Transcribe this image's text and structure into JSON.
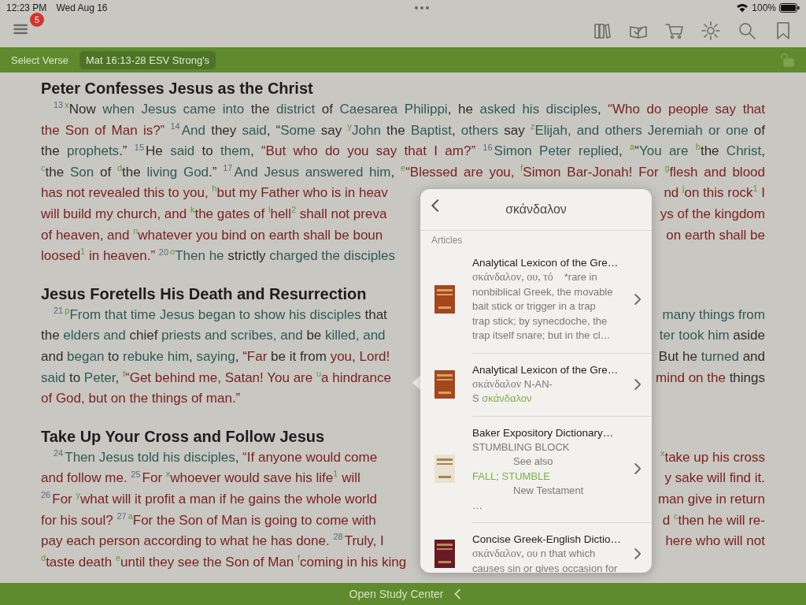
{
  "status_bar": {
    "time": "12:23 PM",
    "date": "Wed Aug 16",
    "battery": "100%"
  },
  "toolbar": {
    "menu_badge": "5"
  },
  "verse_bar": {
    "select_label": "Select Verse",
    "reference": "Mat 16:13-28 ESV Strong's"
  },
  "sections": [
    {
      "heading": "Peter Confesses Jesus as the Christ",
      "lines": [
        {
          "left": [
            {
              "text": "13",
              "kind": "verse"
            },
            {
              "text": "x",
              "kind": "note"
            },
            {
              "text": "Now ",
              "kind": "plain"
            },
            {
              "text": "when Jesus came into",
              "kind": "link"
            },
            {
              "text": " the ",
              "kind": "plain"
            },
            {
              "text": "district",
              "kind": "link"
            },
            {
              "text": " of ",
              "kind": "plain"
            },
            {
              "text": "Caesarea Philippi",
              "kind": "link"
            },
            {
              "text": ", he ",
              "kind": "plain"
            },
            {
              "text": "asked his disciples",
              "kind": "link"
            },
            {
              "text": ", ",
              "kind": "plain"
            },
            {
              "text": "“Who do people say that",
              "kind": "red"
            }
          ]
        },
        {
          "left": [
            {
              "text": "the Son of Man is?” ",
              "kind": "red"
            },
            {
              "text": "14",
              "kind": "verse"
            },
            {
              "text": "And",
              "kind": "link"
            },
            {
              "text": " they ",
              "kind": "plain"
            },
            {
              "text": "said",
              "kind": "link"
            },
            {
              "text": ", “",
              "kind": "plain"
            },
            {
              "text": "Some",
              "kind": "link"
            },
            {
              "text": " say ",
              "kind": "plain"
            },
            {
              "text": "y",
              "kind": "note"
            },
            {
              "text": "John",
              "kind": "link"
            },
            {
              "text": " the ",
              "kind": "plain"
            },
            {
              "text": "Baptist",
              "kind": "link"
            },
            {
              "text": ", ",
              "kind": "plain"
            },
            {
              "text": "others",
              "kind": "link"
            },
            {
              "text": " say ",
              "kind": "plain"
            },
            {
              "text": "z",
              "kind": "note"
            },
            {
              "text": "Elijah, and others Jeremiah or one",
              "kind": "link"
            },
            {
              "text": " of",
              "kind": "plain"
            }
          ]
        },
        {
          "left": [
            {
              "text": "the ",
              "kind": "plain"
            },
            {
              "text": "prophets",
              "kind": "link"
            },
            {
              "text": ".” ",
              "kind": "plain"
            },
            {
              "text": "15",
              "kind": "verse"
            },
            {
              "text": "He ",
              "kind": "plain"
            },
            {
              "text": "said",
              "kind": "link"
            },
            {
              "text": " to ",
              "kind": "plain"
            },
            {
              "text": "them",
              "kind": "link"
            },
            {
              "text": ", ",
              "kind": "plain"
            },
            {
              "text": "“But who do you say that I am?” ",
              "kind": "red"
            },
            {
              "text": "16",
              "kind": "verse"
            },
            {
              "text": "Simon Peter replied",
              "kind": "link"
            },
            {
              "text": ", ",
              "kind": "plain"
            },
            {
              "text": "a",
              "kind": "note"
            },
            {
              "text": "“",
              "kind": "plain"
            },
            {
              "text": "You are ",
              "kind": "link"
            },
            {
              "text": "b",
              "kind": "note"
            },
            {
              "text": "the ",
              "kind": "plain"
            },
            {
              "text": "Christ",
              "kind": "link"
            },
            {
              "text": ",",
              "kind": "plain"
            }
          ]
        },
        {
          "left": [
            {
              "text": "c",
              "kind": "note"
            },
            {
              "text": "the ",
              "kind": "plain"
            },
            {
              "text": "Son",
              "kind": "link"
            },
            {
              "text": " of ",
              "kind": "plain"
            },
            {
              "text": "d",
              "kind": "note"
            },
            {
              "text": "the ",
              "kind": "plain"
            },
            {
              "text": "living God",
              "kind": "link"
            },
            {
              "text": ".” ",
              "kind": "plain"
            },
            {
              "text": "17",
              "kind": "verse"
            },
            {
              "text": "And Jesus answered him",
              "kind": "link"
            },
            {
              "text": ", ",
              "kind": "plain"
            },
            {
              "text": "e",
              "kind": "note"
            },
            {
              "text": "“Blessed are you, ",
              "kind": "red"
            },
            {
              "text": "f",
              "kind": "note"
            },
            {
              "text": "Simon Bar-Jonah! For ",
              "kind": "red"
            },
            {
              "text": "g",
              "kind": "note"
            },
            {
              "text": "flesh and blood",
              "kind": "red"
            }
          ]
        },
        {
          "left": [
            {
              "text": "has not revealed this to you, ",
              "kind": "red"
            },
            {
              "text": "h",
              "kind": "note"
            },
            {
              "text": "but my Father who is in heav",
              "kind": "red"
            }
          ],
          "right": [
            {
              "text": "nd ",
              "kind": "red"
            },
            {
              "text": "j",
              "kind": "note"
            },
            {
              "text": "on this rock",
              "kind": "red"
            },
            {
              "text": "1",
              "kind": "footnote"
            },
            {
              "text": " I",
              "kind": "red"
            }
          ]
        },
        {
          "left": [
            {
              "text": "will build my church, and ",
              "kind": "red"
            },
            {
              "text": "k",
              "kind": "note"
            },
            {
              "text": "the gates of ",
              "kind": "red"
            },
            {
              "text": "l",
              "kind": "note"
            },
            {
              "text": "hell",
              "kind": "red"
            },
            {
              "text": "2",
              "kind": "footnote"
            },
            {
              "text": " shall not preva",
              "kind": "red"
            }
          ],
          "right": [
            {
              "text": "ys of the kingdom",
              "kind": "red"
            }
          ]
        },
        {
          "left": [
            {
              "text": "of heaven, and ",
              "kind": "red"
            },
            {
              "text": "n",
              "kind": "note"
            },
            {
              "text": "whatever you bind on earth shall be boun",
              "kind": "red"
            }
          ],
          "right": [
            {
              "text": "on earth shall be",
              "kind": "red"
            }
          ]
        },
        {
          "left": [
            {
              "text": "loosed",
              "kind": "red"
            },
            {
              "text": "1",
              "kind": "footnote"
            },
            {
              "text": " in heaven.” ",
              "kind": "red"
            },
            {
              "text": "20",
              "kind": "verse"
            },
            {
              "text": "o",
              "kind": "note"
            },
            {
              "text": "Then he",
              "kind": "link"
            },
            {
              "text": " strictly ",
              "kind": "plain"
            },
            {
              "text": "charged the disciples",
              "kind": "link"
            }
          ]
        }
      ]
    },
    {
      "heading": "Jesus Foretells His Death and Resurrection",
      "lines": [
        {
          "left": [
            {
              "text": "21",
              "kind": "verse"
            },
            {
              "text": "p",
              "kind": "note"
            },
            {
              "text": "From that time Jesus began to show his disciples",
              "kind": "link"
            },
            {
              "text": " that",
              "kind": "plain"
            }
          ],
          "right": [
            {
              "text": "many things from",
              "kind": "link"
            }
          ]
        },
        {
          "left": [
            {
              "text": "the ",
              "kind": "plain"
            },
            {
              "text": "elders and",
              "kind": "link"
            },
            {
              "text": " chief ",
              "kind": "plain"
            },
            {
              "text": "priests and scribes, and",
              "kind": "link"
            },
            {
              "text": " be ",
              "kind": "plain"
            },
            {
              "text": "killed, and",
              "kind": "link"
            }
          ],
          "right": [
            {
              "text": "ter took him",
              "kind": "link"
            },
            {
              "text": " aside",
              "kind": "plain"
            }
          ]
        },
        {
          "left": [
            {
              "text": "and ",
              "kind": "plain"
            },
            {
              "text": "began",
              "kind": "link"
            },
            {
              "text": " to ",
              "kind": "plain"
            },
            {
              "text": "rebuke him",
              "kind": "link"
            },
            {
              "text": ", ",
              "kind": "plain"
            },
            {
              "text": "saying",
              "kind": "link"
            },
            {
              "text": ", “",
              "kind": "plain"
            },
            {
              "text": "Far",
              "kind": "red"
            },
            {
              "text": " be it from ",
              "kind": "plain"
            },
            {
              "text": "you",
              "kind": "red"
            },
            {
              "text": ", ",
              "kind": "plain"
            },
            {
              "text": "Lord!",
              "kind": "red"
            }
          ],
          "right": [
            {
              "text": "But he ",
              "kind": "plain"
            },
            {
              "text": "turned",
              "kind": "link"
            },
            {
              "text": " and",
              "kind": "plain"
            }
          ]
        },
        {
          "left": [
            {
              "text": "said",
              "kind": "link"
            },
            {
              "text": " to ",
              "kind": "plain"
            },
            {
              "text": "Peter",
              "kind": "link"
            },
            {
              "text": ", ",
              "kind": "plain"
            },
            {
              "text": "t",
              "kind": "note"
            },
            {
              "text": "“Get behind me, Satan! You are ",
              "kind": "red"
            },
            {
              "text": "u",
              "kind": "note"
            },
            {
              "text": "a hindrance",
              "kind": "red"
            }
          ],
          "right": [
            {
              "text": "mind on the",
              "kind": "red"
            },
            {
              "text": " things",
              "kind": "plain"
            }
          ]
        },
        {
          "left": [
            {
              "text": "of God, but on the things of man.”",
              "kind": "red"
            }
          ]
        }
      ]
    },
    {
      "heading": "Take Up Your Cross and Follow Jesus",
      "lines": [
        {
          "left": [
            {
              "text": "24",
              "kind": "verse"
            },
            {
              "text": "Then Jesus told his disciples",
              "kind": "link"
            },
            {
              "text": ", ",
              "kind": "plain"
            },
            {
              "text": "“If anyone would come",
              "kind": "red"
            }
          ],
          "right": [
            {
              "text": "x",
              "kind": "note"
            },
            {
              "text": "take up his cross",
              "kind": "red"
            }
          ]
        },
        {
          "left": [
            {
              "text": "and follow me. ",
              "kind": "red"
            },
            {
              "text": "25",
              "kind": "verse"
            },
            {
              "text": "For ",
              "kind": "red"
            },
            {
              "text": "x",
              "kind": "note"
            },
            {
              "text": "whoever would save his life",
              "kind": "red"
            },
            {
              "text": "1",
              "kind": "footnote"
            },
            {
              "text": " will",
              "kind": "red"
            }
          ],
          "right": [
            {
              "text": "y sake will find it.",
              "kind": "red"
            }
          ]
        },
        {
          "left": [
            {
              "text": "26",
              "kind": "verse"
            },
            {
              "text": "For ",
              "kind": "red"
            },
            {
              "text": "y",
              "kind": "note"
            },
            {
              "text": "what will it profit a man if he gains the whole world",
              "kind": "red"
            }
          ],
          "right": [
            {
              "text": "man give in return",
              "kind": "red"
            }
          ]
        },
        {
          "left": [
            {
              "text": "for his soul? ",
              "kind": "red"
            },
            {
              "text": "27",
              "kind": "verse"
            },
            {
              "text": "a",
              "kind": "note"
            },
            {
              "text": "For the Son of Man is going to come with",
              "kind": "red"
            }
          ],
          "right": [
            {
              "text": "d ",
              "kind": "red"
            },
            {
              "text": "c",
              "kind": "note"
            },
            {
              "text": "then he will re-",
              "kind": "red"
            }
          ]
        },
        {
          "left": [
            {
              "text": "pay each person according to what he has done. ",
              "kind": "red"
            },
            {
              "text": "28",
              "kind": "verse"
            },
            {
              "text": "Truly, I",
              "kind": "red"
            }
          ],
          "right": [
            {
              "text": "here who will not",
              "kind": "red"
            }
          ]
        },
        {
          "left": [
            {
              "text": "d",
              "kind": "note"
            },
            {
              "text": "taste death ",
              "kind": "red"
            },
            {
              "text": "e",
              "kind": "note"
            },
            {
              "text": "until they see the Son of Man ",
              "kind": "red"
            },
            {
              "text": "f",
              "kind": "note"
            },
            {
              "text": "coming in his king",
              "kind": "red"
            }
          ]
        }
      ]
    }
  ],
  "popup": {
    "title": "σκάνδαλον",
    "section_label": "Articles",
    "articles": [
      {
        "kind": "lexicon",
        "title": "Analytical Lexicon of the Gre…",
        "lines": [
          [
            {
              "text": "σκάνδαλον, ου, τό",
              "kind": "greek"
            },
            {
              "text": "*rare in",
              "kind": "aside"
            }
          ],
          [
            {
              "text": "nonbiblical Greek, the movable",
              "kind": "plain"
            }
          ],
          [
            {
              "text": "bait stick or trigger in a trap",
              "kind": "plain"
            }
          ],
          [
            {
              "text": "trap stick; by synecdoche, the",
              "kind": "plain"
            }
          ],
          [
            {
              "text": "trap itself snare; but in the cl…",
              "kind": "plain"
            }
          ]
        ]
      },
      {
        "kind": "lexicon",
        "title": "Analytical Lexicon of the Gre…",
        "lines": [
          [
            {
              "text": "σκάνδαλον",
              "kind": "greek"
            },
            {
              "text": " N-AN-",
              "kind": "plain"
            }
          ],
          [
            {
              "text": "S ",
              "kind": "plain"
            },
            {
              "text": "σκάνδαλον",
              "kind": "link"
            }
          ]
        ]
      },
      {
        "kind": "dictionary",
        "title": "Baker Expository Dictionary…",
        "lines": [
          [
            {
              "text": "STUMBLING BLOCK",
              "kind": "plain"
            }
          ],
          [
            {
              "text": "See also",
              "kind": "indent"
            }
          ],
          [
            {
              "text": "FALL",
              "kind": "link"
            },
            {
              "text": "; ",
              "kind": "plain"
            },
            {
              "text": "STUMBLE",
              "kind": "link"
            }
          ],
          [
            {
              "text": "New Testament",
              "kind": "indent"
            }
          ],
          [
            {
              "text": "…",
              "kind": "plain"
            }
          ]
        ]
      },
      {
        "kind": "concise",
        "title": "Concise Greek-English Dictio…",
        "lines": [
          [
            {
              "text": "σκάνδαλον, ου",
              "kind": "greek"
            },
            {
              "text": " n that which",
              "kind": "plain"
            }
          ],
          [
            {
              "text": "causes sin or gives occasion for",
              "kind": "plain"
            }
          ]
        ]
      }
    ]
  },
  "bottom_bar": {
    "label": "Open Study Center"
  }
}
